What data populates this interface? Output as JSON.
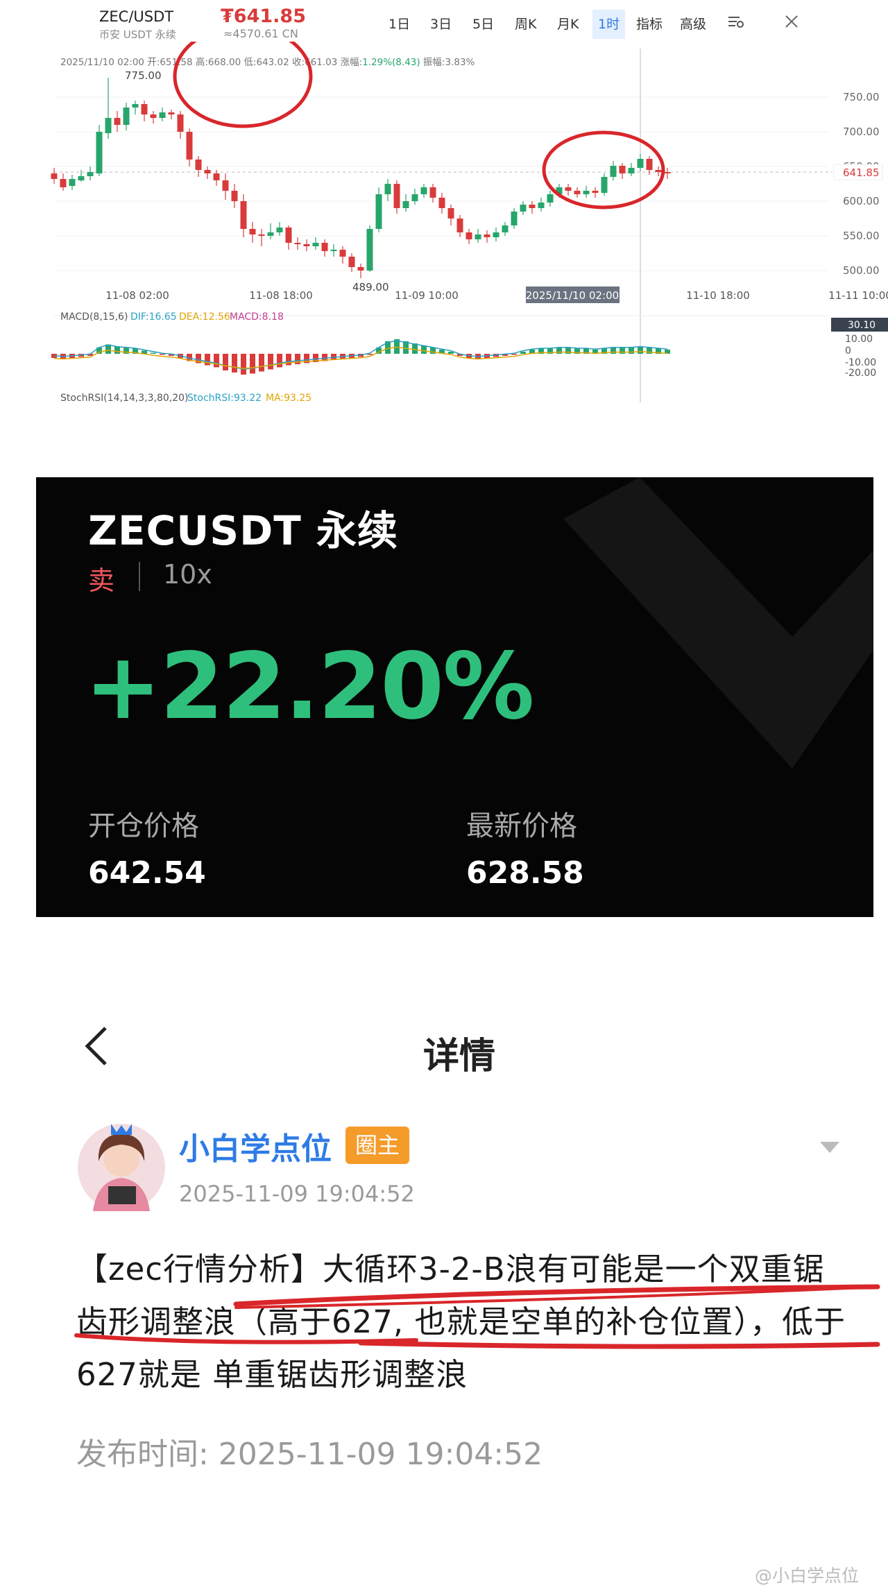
{
  "chart": {
    "pair": "ZEC/USDT",
    "pair_sub": "币安 USDT 永续",
    "price": "₮641.85",
    "price_cny": "≈4570.61 CN",
    "timeframes": [
      "1日",
      "3日",
      "5日",
      "周K",
      "月K",
      "1时",
      "指标",
      "高级"
    ],
    "ohlc_prefix": "2025/11/10 02:00 开:651.58 高:668.00 低:643.02 收:661.03 涨幅:",
    "ohlc_change": "1.29%(8.43)",
    "ohlc_suffix": " 振幅:3.83%",
    "high_label": "775.00",
    "low_label": "489.00",
    "price_axis": [
      "750.00",
      "700.00",
      "650.00",
      "600.00",
      "550.00",
      "500.00"
    ],
    "current_price_tag": "641.85",
    "time_axis": [
      "11-08 02:00",
      "11-08 18:00",
      "11-09 10:00",
      "2025/11/10 02:00",
      "11-10 18:00",
      "11-11 10:00"
    ],
    "macd_label": "MACD(8,15,6)",
    "macd_dif": "DIF:16.65",
    "macd_dea": "DEA:12.56",
    "macd_macd": "MACD:8.18",
    "macd_axis": [
      "30.10",
      "10.00",
      "0",
      "-10.00",
      "-20.00"
    ],
    "stoch_label": "StochRSI(14,14,3,3,80,20)",
    "stoch_value": "StochRSI:93.22",
    "stoch_ma": "MA:93.25",
    "colors": {
      "up": "#27a56b",
      "down": "#d93b3b",
      "annotation": "#d9262a"
    }
  },
  "chart_data": {
    "type": "candlestick",
    "series": [
      {
        "name": "ZEC/USDT 1时",
        "values": [
          [
            640,
            632,
            648,
            625
          ],
          [
            632,
            620,
            640,
            615
          ],
          [
            622,
            632,
            638,
            616
          ],
          [
            630,
            636,
            645,
            628
          ],
          [
            636,
            642,
            650,
            630
          ],
          [
            640,
            700,
            710,
            636
          ],
          [
            698,
            720,
            778,
            690
          ],
          [
            720,
            710,
            730,
            700
          ],
          [
            710,
            735,
            742,
            702
          ],
          [
            735,
            740,
            745,
            725
          ],
          [
            740,
            725,
            745,
            715
          ],
          [
            725,
            720,
            730,
            712
          ],
          [
            720,
            728,
            735,
            715
          ],
          [
            728,
            725,
            732,
            718
          ],
          [
            725,
            700,
            730,
            690
          ],
          [
            700,
            660,
            705,
            650
          ],
          [
            660,
            645,
            665,
            635
          ],
          [
            645,
            640,
            650,
            632
          ],
          [
            640,
            630,
            645,
            622
          ],
          [
            630,
            615,
            640,
            602
          ],
          [
            615,
            600,
            625,
            590
          ],
          [
            600,
            560,
            610,
            548
          ],
          [
            560,
            552,
            570,
            540
          ],
          [
            552,
            550,
            560,
            535
          ],
          [
            550,
            555,
            568,
            545
          ],
          [
            555,
            562,
            570,
            550
          ],
          [
            562,
            540,
            565,
            530
          ],
          [
            540,
            538,
            548,
            530
          ],
          [
            538,
            535,
            545,
            528
          ],
          [
            535,
            540,
            548,
            530
          ],
          [
            540,
            528,
            545,
            520
          ],
          [
            528,
            530,
            538,
            520
          ],
          [
            530,
            520,
            535,
            510
          ],
          [
            520,
            505,
            525,
            498
          ],
          [
            505,
            500,
            510,
            489
          ],
          [
            500,
            560,
            565,
            498
          ],
          [
            560,
            610,
            620,
            555
          ],
          [
            610,
            625,
            632,
            600
          ],
          [
            625,
            590,
            630,
            582
          ],
          [
            590,
            600,
            610,
            585
          ],
          [
            600,
            610,
            618,
            595
          ],
          [
            610,
            620,
            625,
            605
          ],
          [
            620,
            605,
            625,
            598
          ],
          [
            605,
            590,
            612,
            582
          ],
          [
            590,
            575,
            595,
            565
          ],
          [
            575,
            555,
            580,
            548
          ],
          [
            555,
            545,
            560,
            538
          ],
          [
            545,
            552,
            560,
            540
          ],
          [
            552,
            548,
            558,
            540
          ],
          [
            548,
            555,
            562,
            542
          ],
          [
            555,
            565,
            570,
            550
          ],
          [
            565,
            585,
            590,
            560
          ],
          [
            585,
            595,
            600,
            580
          ],
          [
            595,
            590,
            600,
            582
          ],
          [
            590,
            598,
            605,
            585
          ],
          [
            598,
            610,
            615,
            592
          ],
          [
            610,
            620,
            625,
            605
          ],
          [
            620,
            615,
            625,
            608
          ],
          [
            615,
            610,
            620,
            605
          ],
          [
            610,
            615,
            622,
            605
          ],
          [
            615,
            612,
            620,
            605
          ],
          [
            612,
            635,
            640,
            608
          ],
          [
            635,
            651,
            658,
            630
          ],
          [
            651,
            640,
            655,
            632
          ],
          [
            640,
            648,
            655,
            636
          ],
          [
            648,
            661,
            668,
            643
          ],
          [
            661,
            645,
            665,
            638
          ],
          [
            645,
            642,
            650,
            636
          ],
          [
            642,
            640,
            648,
            632
          ]
        ]
      }
    ],
    "macd": [
      -4,
      -5,
      -4,
      -3,
      -2,
      6,
      9,
      7,
      6,
      5,
      3,
      1,
      -1,
      -2,
      -4,
      -7,
      -9,
      -11,
      -13,
      -16,
      -18,
      -20,
      -19,
      -17,
      -15,
      -13,
      -11,
      -10,
      -9,
      -8,
      -7,
      -6,
      -5,
      -4,
      -3,
      -1,
      6,
      12,
      14,
      12,
      10,
      8,
      6,
      4,
      2,
      -2,
      -4,
      -5,
      -4,
      -3,
      -2,
      -1,
      2,
      4,
      5,
      5,
      6,
      6,
      5,
      5,
      4,
      5,
      6,
      6,
      6,
      7,
      6,
      5,
      4
    ],
    "ylim": [
      480,
      790
    ]
  },
  "position": {
    "symbol": "ZECUSDT 永续",
    "side": "卖",
    "leverage": "10x",
    "pnl": "+22.20%",
    "open_label": "开仓价格",
    "open_value": "642.54",
    "latest_label": "最新价格",
    "latest_value": "628.58"
  },
  "post": {
    "header_title": "详情",
    "author": "小白学点位",
    "badge": "圈主",
    "time": "2025-11-09 19:04:52",
    "body": "【zec行情分析】大循环3-2-B浪有可能是一个双重锯齿形调整浪（高于627, 也就是空单的补仓位置），低于627就是 单重锯齿形调整浪",
    "published": "发布时间: 2025-11-09 19:04:52",
    "watermark": "@小白学点位"
  }
}
